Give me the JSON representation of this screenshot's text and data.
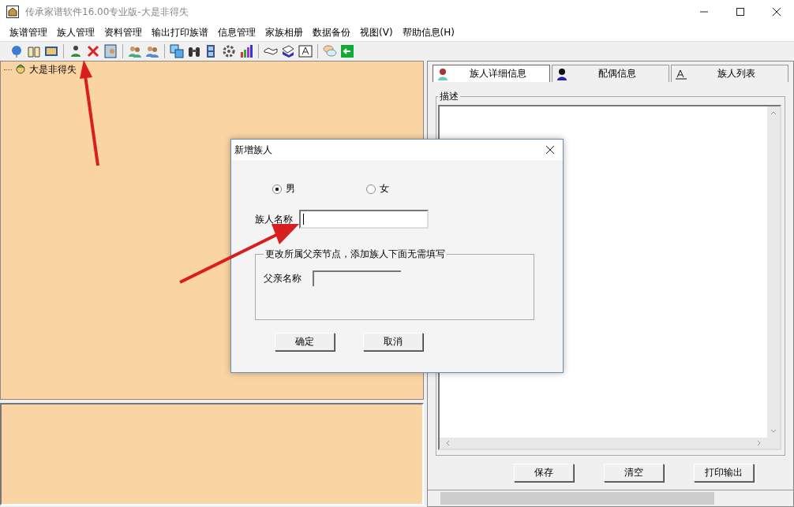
{
  "window": {
    "title": "传承家谱软件16.00专业版-大是非得失"
  },
  "menu": [
    {
      "label": "族谱管理"
    },
    {
      "label": "族人管理"
    },
    {
      "label": "资料管理"
    },
    {
      "label": "输出打印族谱"
    },
    {
      "label": "信息管理"
    },
    {
      "label": "家族相册"
    },
    {
      "label": "数据备份"
    },
    {
      "label": "视图(V)"
    },
    {
      "label": "帮助信息(H)"
    }
  ],
  "tree": [
    {
      "label": "大是非得失"
    }
  ],
  "tabs": [
    {
      "label": "族人详细信息",
      "selected": true
    },
    {
      "label": "配偶信息",
      "selected": false
    },
    {
      "label": "族人列表",
      "selected": false
    }
  ],
  "description": {
    "legend": "描述"
  },
  "panel_buttons": [
    "保存",
    "清空",
    "打印输出"
  ],
  "dialog": {
    "title": "新增族人",
    "gender": [
      {
        "label": "男",
        "selected": true
      },
      {
        "label": "女",
        "selected": false
      }
    ],
    "name_label": "族人名称",
    "father_group": "更改所属父亲节点，添加族人下面无需填写",
    "father_label": "父亲名称",
    "buttons": [
      "确定",
      "取消"
    ]
  }
}
